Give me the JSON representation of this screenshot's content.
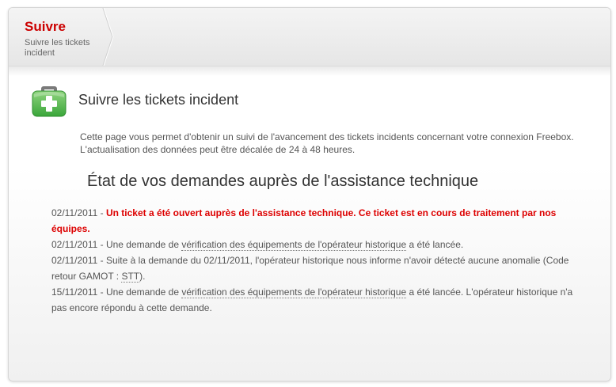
{
  "breadcrumb": {
    "title": "Suivre",
    "subtitle": "Suivre les tickets incident"
  },
  "header": {
    "icon": "first-aid-kit-icon",
    "title": "Suivre les tickets incident"
  },
  "intro": {
    "line1": "Cette page vous permet d'obtenir un suivi de l'avancement des tickets incidents concernant votre connexion Freebox.",
    "line2": "L'actualisation des données peut être décalée de 24 à 48 heures."
  },
  "section": {
    "title": "État de vos demandes auprès de l'assistance technique"
  },
  "entries": [
    {
      "date": "02/11/2011",
      "sep": " - ",
      "alert": "Un ticket a été ouvert auprès de l'assistance technique. Ce ticket est en cours de traitement par nos équipes."
    },
    {
      "date": "02/11/2011",
      "pre": " - Une demande de ",
      "link": "vérification des équipements de l'opérateur historique",
      "post": " a été lancée."
    },
    {
      "date": "02/11/2011",
      "pre": " - Suite à la demande du 02/11/2011, l'opérateur historique nous informe n'avoir détecté aucune anomalie (Code retour GAMOT : ",
      "code": "STT",
      "post": ")."
    },
    {
      "date": "15/11/2011",
      "pre": " - Une demande de ",
      "link": "vérification des équipements de l'opérateur historique",
      "post": " a été lancée. L'opérateur historique n'a pas encore répondu à cette demande."
    }
  ],
  "colors": {
    "brand_red": "#cc0000",
    "alert_red": "#dd0000",
    "icon_green": "#5cb85c",
    "text": "#555555"
  }
}
